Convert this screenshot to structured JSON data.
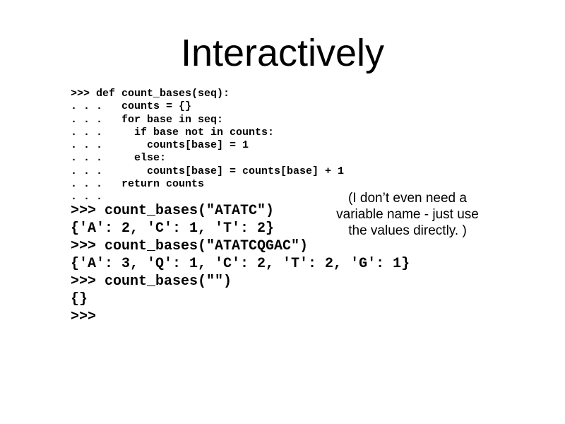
{
  "title": "Interactively",
  "code": ">>> def count_bases(seq):\n. . .   counts = {}\n. . .   for base in seq:\n. . .     if base not in counts:\n. . .       counts[base] = 1\n. . .     else:\n. . .       counts[base] = counts[base] + 1\n. . .   return counts\n. . .",
  "output": ">>> count_bases(\"ATATC\")\n{'A': 2, 'C': 1, 'T': 2}\n>>> count_bases(\"ATATCQGAC\")\n{'A': 3, 'Q': 1, 'C': 2, 'T': 2, 'G': 1}\n>>> count_bases(\"\")\n{}\n>>>",
  "annotation": "(I don’t even need a variable name - just use the values directly. )"
}
